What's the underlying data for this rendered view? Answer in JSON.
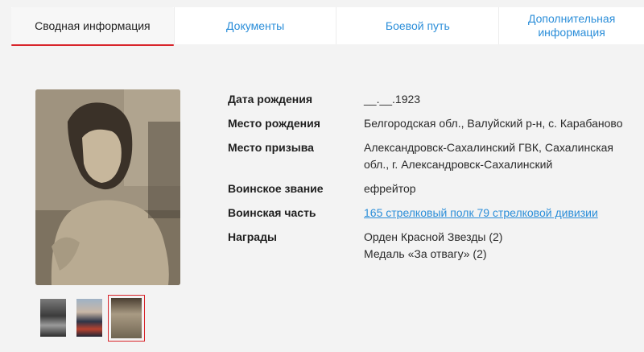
{
  "tabs": [
    {
      "label": "Сводная информация"
    },
    {
      "label": "Документы"
    },
    {
      "label": "Боевой путь"
    },
    {
      "label": "Дополнительная информация"
    }
  ],
  "info": {
    "birth_date": {
      "label": "Дата рождения",
      "value": "__.__.1923"
    },
    "birth_place": {
      "label": "Место рождения",
      "value": "Белгородская обл., Валуйский р-н, с. Карабаново"
    },
    "draft_place": {
      "label": "Место призыва",
      "value": "Александровск-Сахалинский ГВК, Сахалинская обл., г. Александровск-Сахалинский"
    },
    "rank": {
      "label": "Воинское звание",
      "value": "ефрейтор"
    },
    "unit": {
      "label": "Воинская часть",
      "value": "165 стрелковый полк 79 стрелковой дивизии"
    },
    "awards": {
      "label": "Награды",
      "items": [
        "Орден Красной Звезды (2)",
        "Медаль «За отвагу» (2)"
      ]
    }
  },
  "colors": {
    "accent": "#d8252b",
    "link": "#2b8ed9"
  }
}
